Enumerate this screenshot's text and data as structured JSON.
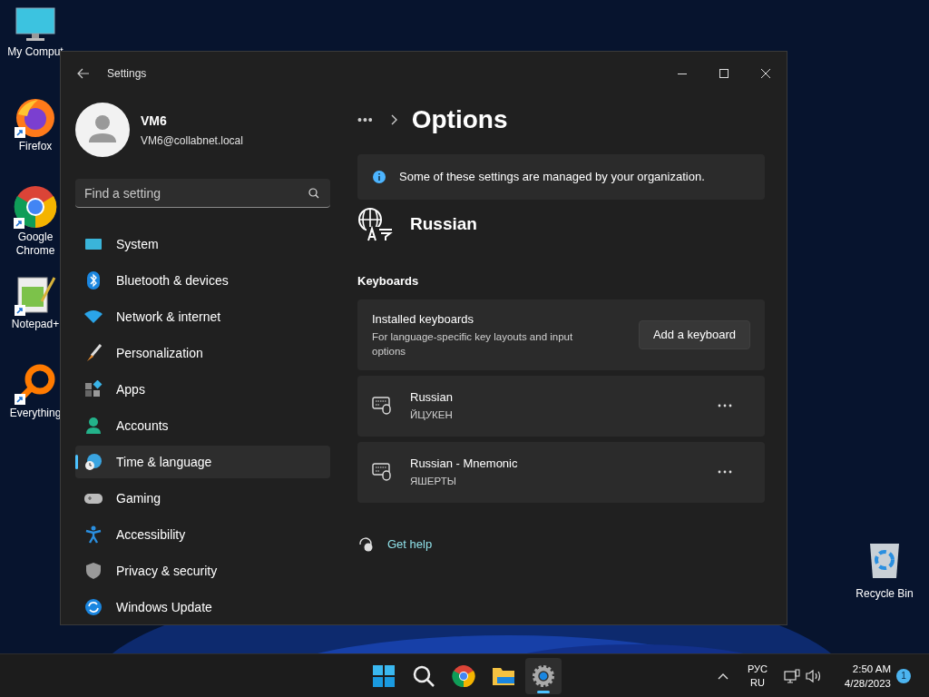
{
  "desktop_icons": [
    {
      "label": "My Comput",
      "kind": "monitor",
      "shortcut": false
    },
    {
      "label": "Firefox",
      "kind": "firefox",
      "shortcut": true
    },
    {
      "label": "Google Chrome",
      "kind": "chrome",
      "shortcut": true
    },
    {
      "label": "Notepad+",
      "kind": "notepad",
      "shortcut": true
    },
    {
      "label": "Everything",
      "kind": "everything",
      "shortcut": true
    }
  ],
  "recycle_bin": {
    "label": "Recycle Bin"
  },
  "window": {
    "title": "Settings"
  },
  "account": {
    "name": "VM6",
    "email": "VM6@collabnet.local"
  },
  "search": {
    "placeholder": "Find a setting"
  },
  "nav": [
    {
      "label": "System",
      "kind": "system",
      "selected": false
    },
    {
      "label": "Bluetooth & devices",
      "kind": "bluetooth",
      "selected": false
    },
    {
      "label": "Network & internet",
      "kind": "network",
      "selected": false
    },
    {
      "label": "Personalization",
      "kind": "brush",
      "selected": false
    },
    {
      "label": "Apps",
      "kind": "apps",
      "selected": false
    },
    {
      "label": "Accounts",
      "kind": "accounts",
      "selected": false
    },
    {
      "label": "Time & language",
      "kind": "time",
      "selected": true
    },
    {
      "label": "Gaming",
      "kind": "gaming",
      "selected": false
    },
    {
      "label": "Accessibility",
      "kind": "accessibility",
      "selected": false
    },
    {
      "label": "Privacy & security",
      "kind": "privacy",
      "selected": false
    },
    {
      "label": "Windows Update",
      "kind": "update",
      "selected": false
    }
  ],
  "breadcrumb": {
    "overflow": "•••",
    "title": "Options"
  },
  "info_banner": "Some of these settings are managed by your organization.",
  "language": "Russian",
  "section": "Keyboards",
  "installed": {
    "title": "Installed keyboards",
    "description": "For language-specific key layouts and input options",
    "button": "Add a keyboard"
  },
  "keyboards": [
    {
      "name": "Russian",
      "layout": "ЙЦУКЕН"
    },
    {
      "name": "Russian - Mnemonic",
      "layout": "ЯШЕРТЫ"
    }
  ],
  "get_help": "Get help",
  "taskbar": {
    "apps": [
      {
        "kind": "start",
        "selected": false
      },
      {
        "kind": "search",
        "selected": false
      },
      {
        "kind": "chrome",
        "selected": false
      },
      {
        "kind": "explorer",
        "selected": false
      },
      {
        "kind": "settings",
        "selected": true
      }
    ],
    "lang_top": "РУС",
    "lang_bottom": "RU",
    "time": "2:50 AM",
    "date": "4/28/2023",
    "notifications": "1"
  }
}
